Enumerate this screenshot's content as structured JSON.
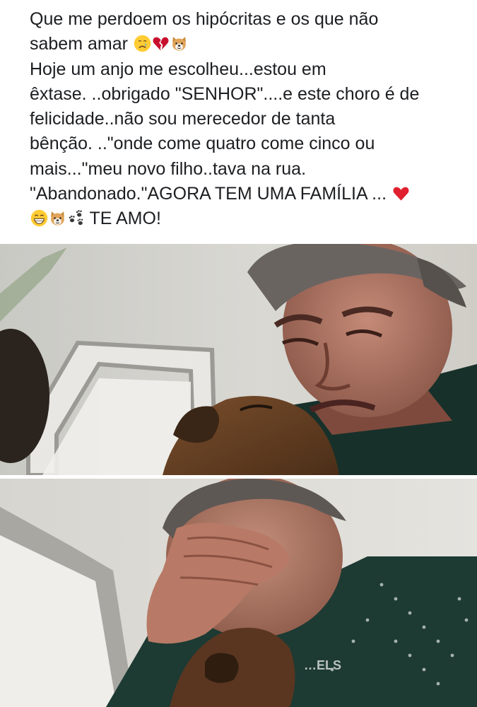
{
  "post": {
    "line1": "Que me perdoem os hipócritas e os que não",
    "line2": "sabem amar",
    "line3": "Hoje um anjo me escolheu...estou em",
    "line4": "êxtase. ..obrigado \"SENHOR\"....e este choro é de",
    "line5": "felicidade..não sou merecedor de tanta",
    "line6": "bênção. ..\"onde come quatro come cinco ou",
    "line7": "mais...\"meu novo filho..tava na rua.",
    "line8": "\"Abandonado.\"AGORA TEM UMA FAMÍLIA ...",
    "line9": "TE AMO!",
    "emojis_after_line2": [
      "crying-face-icon",
      "broken-heart-icon",
      "dog-face-icon"
    ],
    "emojis_after_line8": [
      "red-heart-icon"
    ],
    "emojis_before_line9": [
      "grinning-face-icon",
      "dog-face-icon",
      "paw-prints-icon"
    ]
  },
  "photos": [
    {
      "name": "photo-man-hugging-dog",
      "shirt_print": ""
    },
    {
      "name": "photo-man-crying-with-dog",
      "shirt_print": "…ELS"
    }
  ],
  "colors": {
    "text": "#1c1e21",
    "background": "#ffffff",
    "heart": "#e0202e",
    "broken_heart": "#c8102e",
    "emoji_yellow": "#ffcc33"
  }
}
